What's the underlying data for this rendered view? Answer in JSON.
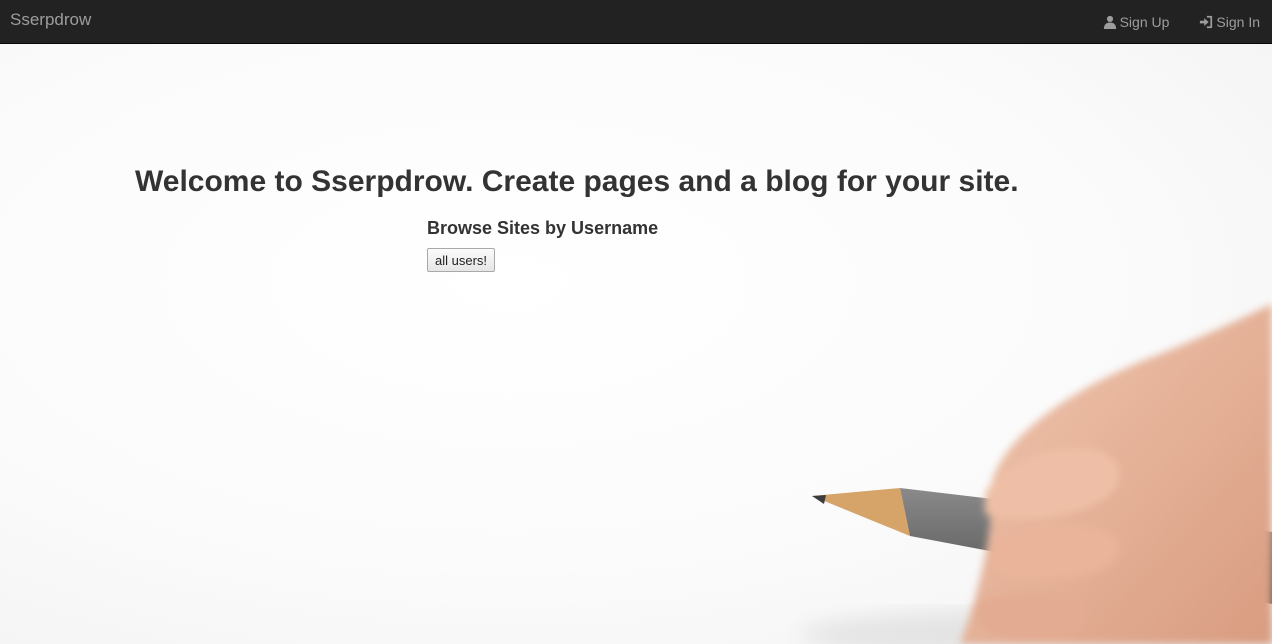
{
  "navbar": {
    "brand": "Sserpdrow",
    "links": [
      {
        "label": "Sign Up",
        "icon": "user-icon"
      },
      {
        "label": "Sign In",
        "icon": "sign-in-icon"
      }
    ]
  },
  "main": {
    "headline": "Welcome to Sserpdrow. Create pages and a blog for your site.",
    "browse_heading": "Browse Sites by Username",
    "all_users_button": "all users!"
  },
  "background": {
    "image": "hand-holding-pencil",
    "colors": {
      "paper": "#fafafa",
      "skin": "#e8b79e",
      "pencil_body": "#6b6b6b",
      "pencil_wood": "#d9a86a"
    }
  }
}
